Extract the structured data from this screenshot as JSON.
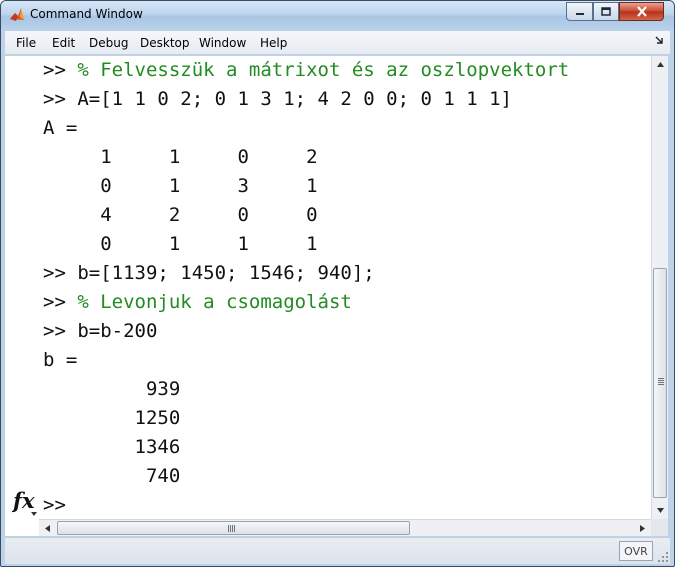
{
  "window": {
    "title": "Command Window",
    "icons": {
      "app": "matlab-logo-icon",
      "minimize": "minimize-icon",
      "maximize": "maximize-icon",
      "close": "close-icon"
    }
  },
  "menu": {
    "items": [
      {
        "label": "File"
      },
      {
        "label": "Edit"
      },
      {
        "label": "Debug"
      },
      {
        "label": "Desktop"
      },
      {
        "label": "Window"
      },
      {
        "label": "Help"
      }
    ],
    "dock_icon": "undock-arrow-icon"
  },
  "console": {
    "lines": [
      {
        "text": ">> ",
        "comment": "% Felvesszük a mátrixot és az oszlopvektort"
      },
      {
        "text": ">> A=[1 1 0 2; 0 1 3 1; 4 2 0 0; 0 1 1 1]",
        "comment": ""
      },
      {
        "text": "A =",
        "comment": ""
      },
      {
        "text": "     1     1     0     2",
        "comment": ""
      },
      {
        "text": "     0     1     3     1",
        "comment": ""
      },
      {
        "text": "     4     2     0     0",
        "comment": ""
      },
      {
        "text": "     0     1     1     1",
        "comment": ""
      },
      {
        "text": ">> b=[1139; 1450; 1546; 940];",
        "comment": ""
      },
      {
        "text": ">> ",
        "comment": "% Levonjuk a csomagolást"
      },
      {
        "text": ">> b=b-200",
        "comment": ""
      },
      {
        "text": "b =",
        "comment": ""
      },
      {
        "text": "         939",
        "comment": ""
      },
      {
        "text": "        1250",
        "comment": ""
      },
      {
        "text": "        1346",
        "comment": ""
      },
      {
        "text": "         740",
        "comment": ""
      },
      {
        "text": ">> ",
        "comment": ""
      }
    ],
    "fx_label": "fx"
  },
  "status": {
    "ovr": "OVR"
  },
  "colors": {
    "comment": "#228b22",
    "text": "#111111",
    "titlebar": "#bcd5ee"
  }
}
